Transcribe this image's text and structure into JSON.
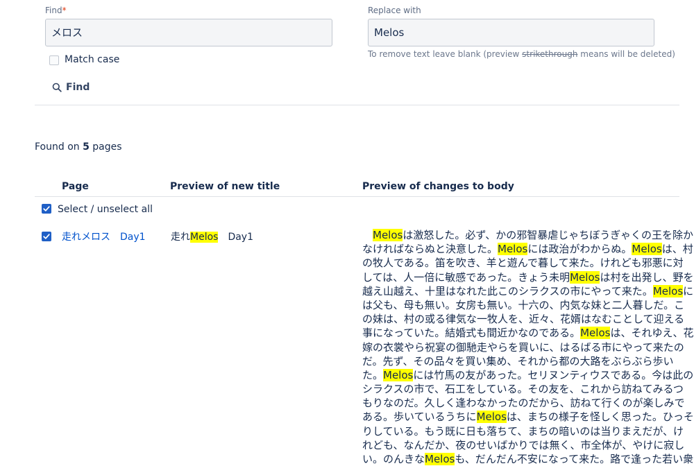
{
  "find": {
    "label": "Find",
    "required_mark": "*",
    "value": "メロス",
    "match_case_label": "Match case",
    "button_label": "Find"
  },
  "replace": {
    "label": "Replace with",
    "value": "Melos",
    "hint_prefix": "To remove text leave blank (preview ",
    "hint_strike": "strikethrough",
    "hint_suffix": " means will be deleted)"
  },
  "results": {
    "found_prefix": "Found on ",
    "count": "5",
    "found_suffix": " pages"
  },
  "table": {
    "columns": [
      "Page",
      "Preview of new title",
      "Preview of changes to body"
    ],
    "select_all_label": "Select / unselect all",
    "rows": [
      {
        "page_link": "走れメロス　Day1",
        "title_before": "走れ",
        "title_highlight": "Melos",
        "title_after": "　Day1",
        "body_lines": [
          [
            [
              "　"
            ],
            [
              "Melos",
              true
            ],
            [
              "は激怒した。必ず、かの邪智暴虐じゃちぼうぎゃくの王を除か"
            ]
          ],
          [
            [
              "なければならぬと決意した。"
            ],
            [
              "Melos",
              true
            ],
            [
              "には政治がわからぬ。"
            ],
            [
              "Melos",
              true
            ],
            [
              "は、村"
            ]
          ],
          [
            [
              "の牧人である。笛を吹き、羊と遊んで暮して来た。けれども邪悪に対"
            ]
          ],
          [
            [
              "しては、人一倍に敏感であった。きょう未明"
            ],
            [
              "Melos",
              true
            ],
            [
              "は村を出発し、野を"
            ]
          ],
          [
            [
              "越え山越え、十里はなれた此このシラクスの市にやって来た。"
            ],
            [
              "Melos",
              true
            ],
            [
              "に"
            ]
          ],
          [
            [
              "は父も、母も無い。女房も無い。十六の、内気な妹と二人暮しだ。こ"
            ]
          ],
          [
            [
              "の妹は、村の或る律気な一牧人を、近々、花婿はなむことして迎える"
            ]
          ],
          [
            [
              "事になっていた。結婚式も間近かなのである。"
            ],
            [
              "Melos",
              true
            ],
            [
              "は、それゆえ、花"
            ]
          ],
          [
            [
              "嫁の衣裳やら祝宴の御馳走やらを買いに、はるばる市にやって来たの"
            ]
          ],
          [
            [
              "だ。先ず、その品々を買い集め、それから都の大路をぶらぶら歩い"
            ]
          ],
          [
            [
              "た。"
            ],
            [
              "Melos",
              true
            ],
            [
              "には竹馬の友があった。セリヌンティウスである。今は此の"
            ]
          ],
          [
            [
              "シラクスの市で、石工をしている。その友を、これから訪ねてみるつ"
            ]
          ],
          [
            [
              "もりなのだ。久しく逢わなかったのだから、訪ねて行くのが楽しみで"
            ]
          ],
          [
            [
              "ある。歩いているうちに"
            ],
            [
              "Melos",
              true
            ],
            [
              "は、まちの様子を怪しく思った。ひっそ"
            ]
          ],
          [
            [
              "りしている。もう既に日も落ちて、まちの暗いのは当りまえだが、け"
            ]
          ],
          [
            [
              "れども、なんだか、夜のせいばかりでは無く、市全体が、やけに寂し"
            ]
          ],
          [
            [
              "い。のんきな"
            ],
            [
              "Melos",
              true
            ],
            [
              "も、だんだん不安になって来た。路で逢った若い衆"
            ]
          ]
        ]
      }
    ]
  },
  "colors": {
    "accent": "#1f5fc6",
    "link": "#0052cc",
    "highlight": "#ffff00"
  }
}
